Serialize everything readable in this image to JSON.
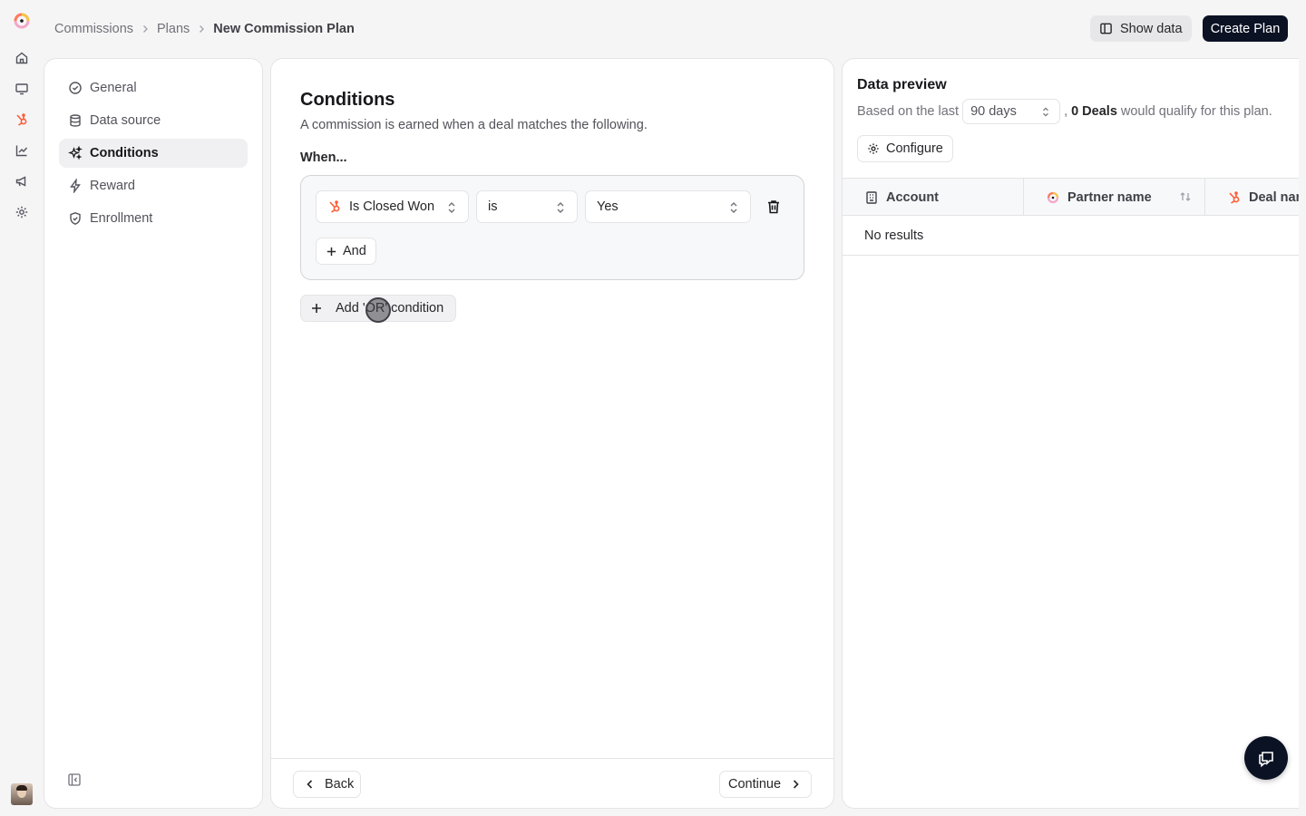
{
  "breadcrumb": {
    "items": [
      "Commissions",
      "Plans"
    ],
    "current": "New Commission Plan"
  },
  "header": {
    "show_data_label": "Show data",
    "create_plan_label": "Create Plan"
  },
  "steps": [
    {
      "label": "General",
      "icon": "check-circle-icon"
    },
    {
      "label": "Data source",
      "icon": "database-icon"
    },
    {
      "label": "Conditions",
      "icon": "sparkles-icon"
    },
    {
      "label": "Reward",
      "icon": "lightning-icon"
    },
    {
      "label": "Enrollment",
      "icon": "shield-check-icon"
    }
  ],
  "active_step": "Conditions",
  "conditions": {
    "title": "Conditions",
    "subtitle": "A commission is earned when a deal matches the following.",
    "when_label": "When...",
    "rule": {
      "field": "Is Closed Won",
      "operator": "is",
      "value": "Yes"
    },
    "and_label": "And",
    "or_label": "Add 'OR' condition"
  },
  "footer": {
    "back_label": "Back",
    "continue_label": "Continue"
  },
  "preview": {
    "title": "Data preview",
    "desc_prefix": "Based on the last",
    "range": "90 days",
    "desc_comma": ",",
    "count": "0 Deals",
    "desc_suffix": "would qualify for this plan.",
    "configure_label": "Configure",
    "columns": [
      "Account",
      "Partner name",
      "Deal name"
    ],
    "empty_text": "No results"
  },
  "colors": {
    "accent": "#0b1224",
    "hubspot": "#ff5c35",
    "active_bg": "#f0f0f2"
  }
}
